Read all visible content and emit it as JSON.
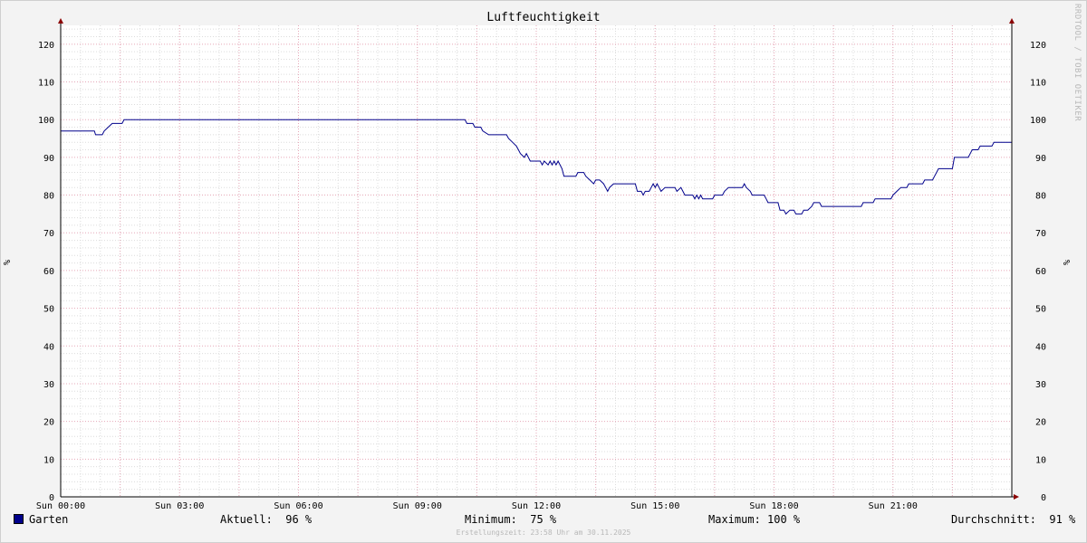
{
  "chart_data": {
    "type": "line",
    "title": "Luftfeuchtigkeit",
    "ylabel": "%",
    "ylim": [
      0,
      125
    ],
    "yticks": [
      0,
      10,
      20,
      30,
      40,
      50,
      60,
      70,
      80,
      90,
      100,
      110,
      120
    ],
    "xlim": [
      0,
      24
    ],
    "xticks": [
      {
        "v": 0,
        "label": "Sun 00:00"
      },
      {
        "v": 3,
        "label": "Sun 03:00"
      },
      {
        "v": 6,
        "label": "Sun 06:00"
      },
      {
        "v": 9,
        "label": "Sun 09:00"
      },
      {
        "v": 12,
        "label": "Sun 12:00"
      },
      {
        "v": 15,
        "label": "Sun 15:00"
      },
      {
        "v": 18,
        "label": "Sun 18:00"
      },
      {
        "v": 21,
        "label": "Sun 21:00"
      }
    ],
    "grid": true,
    "legend_placement": "bottom",
    "series": [
      {
        "name": "Garten",
        "color": "#00008b",
        "points": [
          [
            0.0,
            97
          ],
          [
            0.85,
            97
          ],
          [
            0.88,
            96
          ],
          [
            1.05,
            96
          ],
          [
            1.1,
            97
          ],
          [
            1.2,
            98
          ],
          [
            1.3,
            99
          ],
          [
            1.55,
            99
          ],
          [
            1.6,
            100
          ],
          [
            10.2,
            100
          ],
          [
            10.25,
            99
          ],
          [
            10.4,
            99
          ],
          [
            10.45,
            98
          ],
          [
            10.6,
            98
          ],
          [
            10.65,
            97
          ],
          [
            10.8,
            96
          ],
          [
            11.25,
            96
          ],
          [
            11.3,
            95
          ],
          [
            11.4,
            94
          ],
          [
            11.5,
            93
          ],
          [
            11.55,
            92
          ],
          [
            11.6,
            91
          ],
          [
            11.7,
            90
          ],
          [
            11.75,
            91
          ],
          [
            11.8,
            90
          ],
          [
            11.85,
            89
          ],
          [
            12.1,
            89
          ],
          [
            12.15,
            88
          ],
          [
            12.2,
            89
          ],
          [
            12.3,
            88
          ],
          [
            12.35,
            89
          ],
          [
            12.4,
            88
          ],
          [
            12.45,
            89
          ],
          [
            12.5,
            88
          ],
          [
            12.55,
            89
          ],
          [
            12.65,
            87
          ],
          [
            12.7,
            85
          ],
          [
            13.0,
            85
          ],
          [
            13.05,
            86
          ],
          [
            13.2,
            86
          ],
          [
            13.25,
            85
          ],
          [
            13.35,
            84
          ],
          [
            13.45,
            83
          ],
          [
            13.5,
            84
          ],
          [
            13.6,
            84
          ],
          [
            13.7,
            83
          ],
          [
            13.75,
            82
          ],
          [
            13.8,
            81
          ],
          [
            13.85,
            82
          ],
          [
            13.95,
            83
          ],
          [
            14.5,
            83
          ],
          [
            14.55,
            81
          ],
          [
            14.65,
            81
          ],
          [
            14.7,
            80
          ],
          [
            14.75,
            81
          ],
          [
            14.85,
            81
          ],
          [
            14.9,
            82
          ],
          [
            14.95,
            83
          ],
          [
            15.0,
            82
          ],
          [
            15.05,
            83
          ],
          [
            15.1,
            82
          ],
          [
            15.15,
            81
          ],
          [
            15.25,
            82
          ],
          [
            15.5,
            82
          ],
          [
            15.55,
            81
          ],
          [
            15.65,
            82
          ],
          [
            15.7,
            81
          ],
          [
            15.75,
            80
          ],
          [
            15.95,
            80
          ],
          [
            16.0,
            79
          ],
          [
            16.05,
            80
          ],
          [
            16.1,
            79
          ],
          [
            16.15,
            80
          ],
          [
            16.2,
            79
          ],
          [
            16.45,
            79
          ],
          [
            16.5,
            80
          ],
          [
            16.7,
            80
          ],
          [
            16.75,
            81
          ],
          [
            16.85,
            82
          ],
          [
            17.2,
            82
          ],
          [
            17.25,
            83
          ],
          [
            17.3,
            82
          ],
          [
            17.4,
            81
          ],
          [
            17.45,
            80
          ],
          [
            17.75,
            80
          ],
          [
            17.8,
            79
          ],
          [
            17.85,
            78
          ],
          [
            18.1,
            78
          ],
          [
            18.15,
            76
          ],
          [
            18.25,
            76
          ],
          [
            18.3,
            75
          ],
          [
            18.4,
            76
          ],
          [
            18.5,
            76
          ],
          [
            18.55,
            75
          ],
          [
            18.7,
            75
          ],
          [
            18.75,
            76
          ],
          [
            18.85,
            76
          ],
          [
            18.95,
            77
          ],
          [
            19.0,
            78
          ],
          [
            19.15,
            78
          ],
          [
            19.2,
            77
          ],
          [
            19.4,
            77
          ],
          [
            20.2,
            77
          ],
          [
            20.25,
            78
          ],
          [
            20.5,
            78
          ],
          [
            20.55,
            79
          ],
          [
            20.95,
            79
          ],
          [
            21.0,
            80
          ],
          [
            21.1,
            81
          ],
          [
            21.2,
            82
          ],
          [
            21.35,
            82
          ],
          [
            21.4,
            83
          ],
          [
            21.75,
            83
          ],
          [
            21.8,
            84
          ],
          [
            22.0,
            84
          ],
          [
            22.05,
            85
          ],
          [
            22.1,
            86
          ],
          [
            22.15,
            87
          ],
          [
            22.5,
            87
          ],
          [
            22.55,
            90
          ],
          [
            22.9,
            90
          ],
          [
            22.95,
            91
          ],
          [
            23.0,
            92
          ],
          [
            23.15,
            92
          ],
          [
            23.2,
            93
          ],
          [
            23.5,
            93
          ],
          [
            23.55,
            94
          ],
          [
            23.95,
            94
          ],
          [
            24.0,
            94
          ]
        ],
        "tail_points": [
          [
            24.0,
            94
          ],
          [
            24.2,
            94
          ],
          [
            24.25,
            95
          ],
          [
            24.45,
            95
          ],
          [
            24.5,
            96
          ],
          [
            24.7,
            96
          ]
        ]
      }
    ],
    "stats": {
      "current_label": "Aktuell:",
      "current_value": "96 %",
      "min_label": "Minimum:",
      "min_value": "75 %",
      "max_label": "Maximum:",
      "max_value": "100 %",
      "avg_label": "Durchschnitt:",
      "avg_value": "91 %"
    }
  },
  "side_text": "RRDTOOL / TOBI OETIKER",
  "footer": "Erstellungszeit: 23:58 Uhr am 30.11.2025",
  "colors": {
    "grid_minor": "#dcdcdc",
    "grid_major": "#e6a8b8",
    "axis": "#8b0000",
    "line": "#00008b"
  }
}
